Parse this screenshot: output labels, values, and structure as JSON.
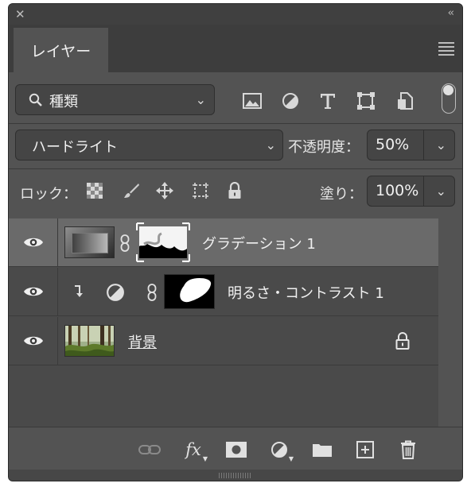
{
  "panel": {
    "tab_title": "レイヤー",
    "menu_icon": "panel-menu-icon"
  },
  "filter": {
    "kind_label": "種類",
    "selected": "種類"
  },
  "blend": {
    "mode": "ハードライト",
    "opacity_label": "不透明度：",
    "opacity_value": "50%"
  },
  "lock": {
    "label": "ロック：",
    "fill_label": "塗り：",
    "fill_value": "100%"
  },
  "layers": [
    {
      "name": "グラデーション 1",
      "visible": true,
      "selected": true
    },
    {
      "name": "明るさ・コントラスト 1",
      "visible": true,
      "selected": false,
      "clipped": true
    },
    {
      "name": "背景",
      "visible": true,
      "selected": false,
      "locked": true
    }
  ],
  "footer": {
    "fx_label": "fx"
  },
  "colors": {
    "panel_bg": "#535353",
    "selected_row": "#6a6a6a",
    "text": "#f0f0f0"
  }
}
